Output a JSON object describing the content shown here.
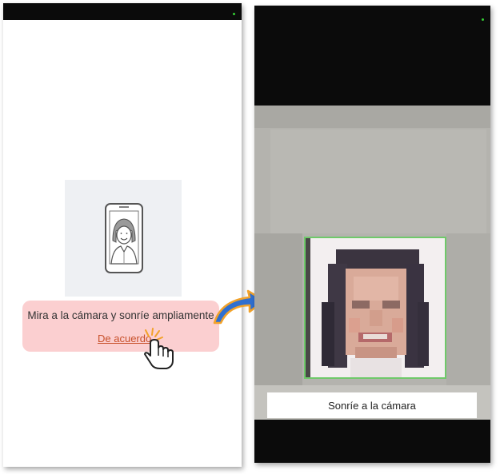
{
  "left_screen": {
    "instruction": "Mira a la cámara y sonríe ampliamente",
    "agree_link": "De acuerdo",
    "card_color": "#fbcfd0",
    "link_color": "#c8502a"
  },
  "right_screen": {
    "caption": "Sonríe a la cámara",
    "frame_color": "#6fc96a"
  },
  "icons": [
    "phone-face-illustration",
    "hand-pointer-icon",
    "curved-arrow-icon",
    "status-indicator-dot"
  ],
  "accent_colors": {
    "arrow_fill": "#2f6fd0",
    "arrow_outline": "#f2a22a"
  }
}
